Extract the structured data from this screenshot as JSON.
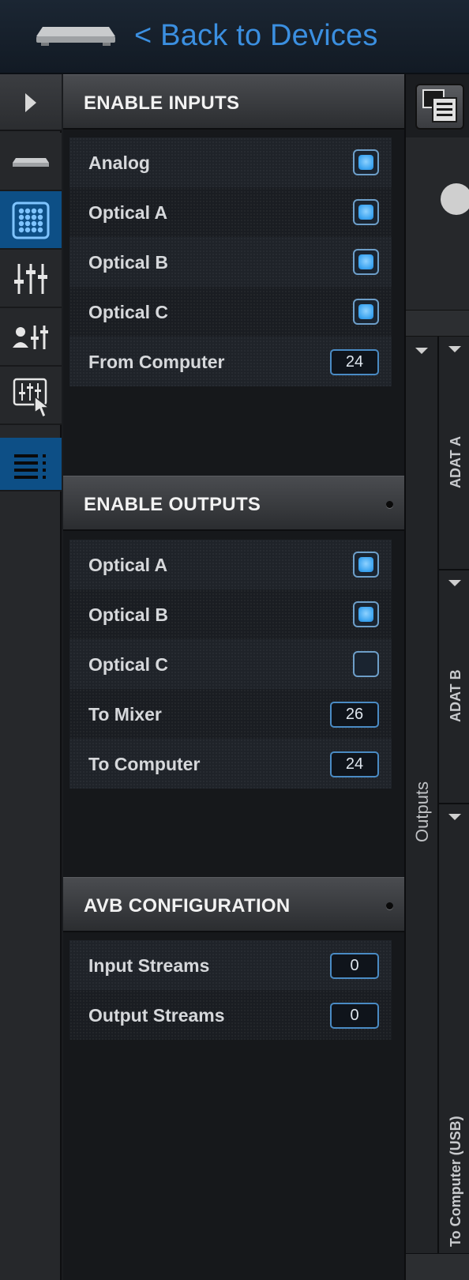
{
  "header": {
    "back_label": "< Back to Devices",
    "device_icon": "rack-device-icon"
  },
  "sidebar": {
    "collapse_icon": "expand-arrow-icon",
    "items": [
      {
        "icon": "device-icon",
        "active": false
      },
      {
        "icon": "routing-grid-icon",
        "active": true
      },
      {
        "icon": "mixer-faders-icon",
        "active": false
      },
      {
        "icon": "user-mix-icon",
        "active": false
      },
      {
        "icon": "touch-mixer-icon",
        "active": false
      },
      {
        "icon": "list-icon",
        "active": true
      }
    ]
  },
  "enable_inputs": {
    "title": "ENABLE INPUTS",
    "rows": [
      {
        "label": "Analog",
        "type": "checkbox",
        "checked": true
      },
      {
        "label": "Optical A",
        "type": "checkbox",
        "checked": true
      },
      {
        "label": "Optical B",
        "type": "checkbox",
        "checked": true
      },
      {
        "label": "Optical C",
        "type": "checkbox",
        "checked": true
      },
      {
        "label": "From Computer",
        "type": "number",
        "value": "24"
      }
    ]
  },
  "enable_outputs": {
    "title": "ENABLE OUTPUTS",
    "rows": [
      {
        "label": "Optical A",
        "type": "checkbox",
        "checked": true
      },
      {
        "label": "Optical B",
        "type": "checkbox",
        "checked": true
      },
      {
        "label": "Optical C",
        "type": "checkbox",
        "checked": false
      },
      {
        "label": "To Mixer",
        "type": "number",
        "value": "26"
      },
      {
        "label": "To Computer",
        "type": "number",
        "value": "24"
      }
    ]
  },
  "avb_configuration": {
    "title": "AVB CONFIGURATION",
    "rows": [
      {
        "label": "Input Streams",
        "type": "number",
        "value": "0"
      },
      {
        "label": "Output Streams",
        "type": "number",
        "value": "0"
      }
    ]
  },
  "right_strip": {
    "routing_icon": "routing-view-icon",
    "outputs_label": "Outputs",
    "groups": [
      "ADAT A",
      "ADAT B",
      "To Computer (USB)"
    ]
  },
  "colors": {
    "accent": "#3b8fe0",
    "active_nav": "#0d4f86",
    "checkbox_on": "#4fb3f5"
  }
}
